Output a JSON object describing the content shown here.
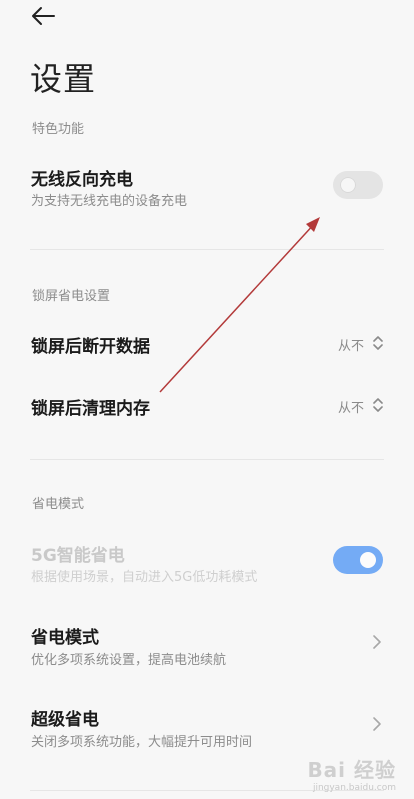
{
  "header": {
    "title": "设置"
  },
  "features": {
    "section_label": "特色功能",
    "reverse_charging": {
      "title": "无线反向充电",
      "subtitle": "为支持无线充电的设备充电",
      "enabled": false
    }
  },
  "lock_screen": {
    "section_label": "锁屏省电设置",
    "items": [
      {
        "title": "锁屏后断开数据",
        "value": "从不"
      },
      {
        "title": "锁屏后清理内存",
        "value": "从不"
      }
    ]
  },
  "power_saving": {
    "section_label": "省电模式",
    "items": [
      {
        "title": "5G智能省电",
        "subtitle": "根据使用场景，自动进入5G低功耗模式",
        "enabled": true,
        "disabled_look": true
      },
      {
        "title": "省电模式",
        "subtitle": "优化多项系统设置，提高电池续航"
      },
      {
        "title": "超级省电",
        "subtitle": "关闭多项系统功能，大幅提升可用时间"
      }
    ]
  },
  "annotation": {
    "arrow_color": "#b33a3a"
  },
  "watermark": {
    "text": "Bai 经验",
    "sub": "jingyan.baidu.com"
  },
  "colors": {
    "accent": "#3e8bf5",
    "background": "#f7f7f7"
  }
}
